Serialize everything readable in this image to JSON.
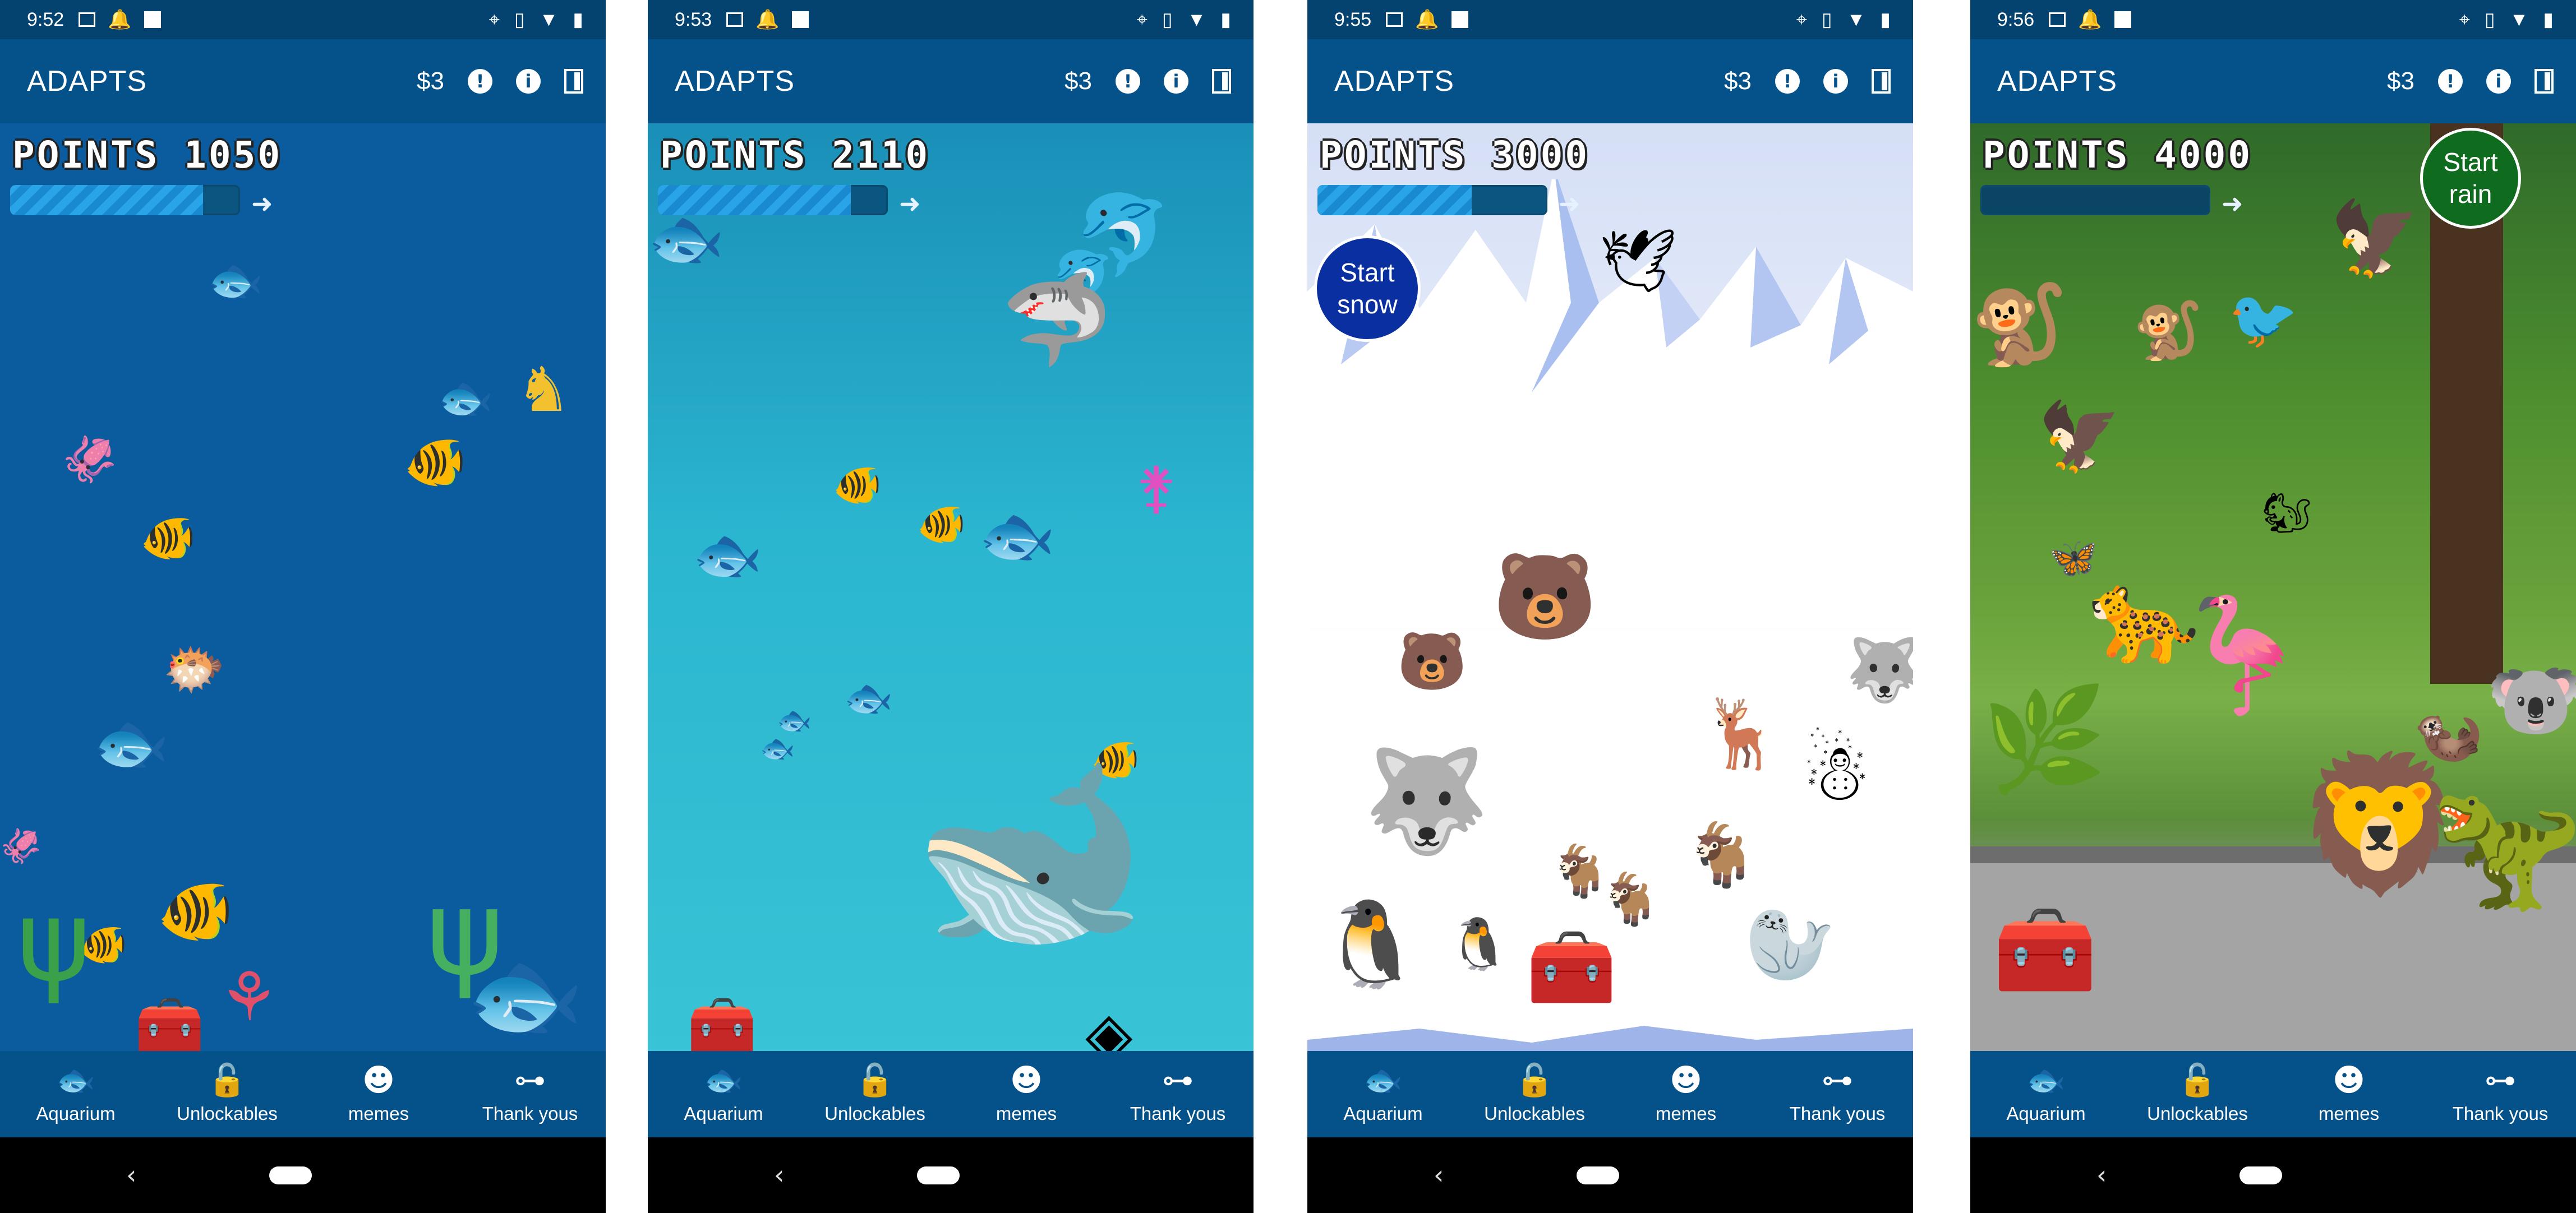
{
  "statusbar": {
    "times": [
      "9:52",
      "9:53",
      "9:55",
      "9:56"
    ]
  },
  "app": {
    "title": "ADAPTS",
    "price": "$3"
  },
  "points": [
    "POINTS 1050",
    "POINTS 2110",
    "POINTS 3000",
    "POINTS 4000"
  ],
  "progress": [
    0.84,
    0.84,
    0.67,
    0.0
  ],
  "weather": {
    "snow_button": "Start\nsnow",
    "rain_button": "Start\nrain"
  },
  "nav": {
    "items": [
      {
        "label": "Aquarium",
        "icon": "fish-icon"
      },
      {
        "label": "Unlockables",
        "icon": "unlock-icon"
      },
      {
        "label": "memes",
        "icon": "smiley-icon"
      },
      {
        "label": "Thank yous",
        "icon": "handshake-icon"
      }
    ]
  },
  "colors": {
    "appbar": "#045289",
    "statusbar": "#04426f",
    "ocean": "#0b5c9e",
    "snow_btn": "#0a2fa0",
    "rain_btn": "#0f6b1d"
  }
}
